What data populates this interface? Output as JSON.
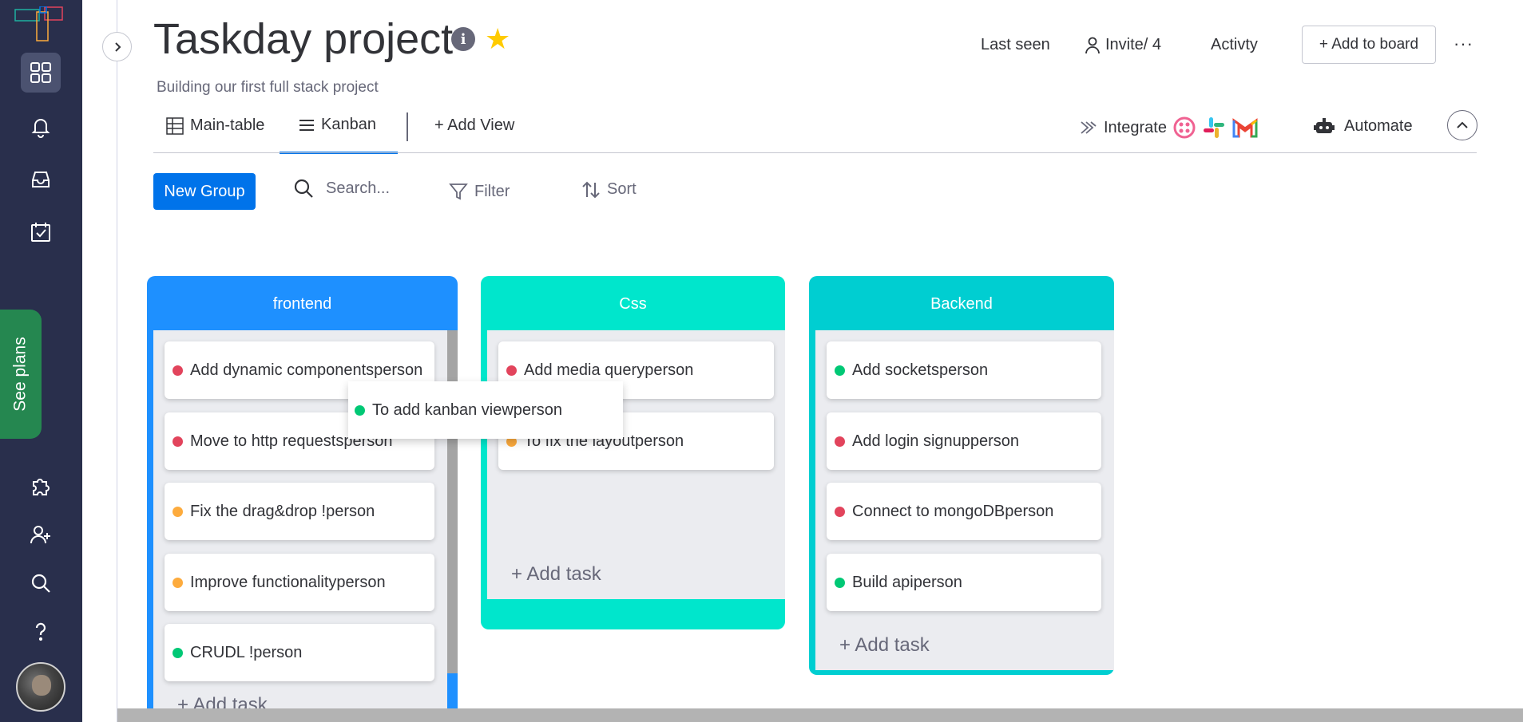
{
  "header": {
    "title": "Taskday project",
    "description": "Building our first full stack project",
    "info_icon": "info-icon",
    "star_icon": "star-icon",
    "last_seen": "Last seen",
    "invite": "Invite/ 4",
    "activity": "Activty",
    "add_to_board": "+ Add to board",
    "more": "···"
  },
  "sidebar": {
    "items": [
      {
        "name": "workspaces",
        "icon": "grid-icon"
      },
      {
        "name": "notifications",
        "icon": "bell-icon"
      },
      {
        "name": "inbox",
        "icon": "inbox-icon"
      },
      {
        "name": "my-work",
        "icon": "calendar-check-icon"
      },
      {
        "name": "apps",
        "icon": "puzzle-icon"
      },
      {
        "name": "invite-members",
        "icon": "add-user-icon"
      },
      {
        "name": "search",
        "icon": "search-icon"
      },
      {
        "name": "help",
        "icon": "help-icon"
      }
    ],
    "see_plans": "See plans"
  },
  "tabs": {
    "main_table": "Main-table",
    "kanban": "Kanban",
    "add_view": "+ Add View",
    "integrate": "Integrate",
    "automate": "Automate"
  },
  "toolbar": {
    "new_group": "New Group",
    "search_placeholder": "Search...",
    "filter": "Filter",
    "sort": "Sort"
  },
  "colors": {
    "sidebar": "#292f4c",
    "accent": "#0073ea",
    "status_red": "#e2445c",
    "status_orange": "#fdab3d",
    "status_green": "#00c875",
    "group_frontend": "#1e90ff",
    "group_css": "#00e6cc",
    "group_backend": "#00ced1"
  },
  "groups": [
    {
      "title": "frontend",
      "tasks": [
        {
          "text": "Add dynamic componentsperson",
          "status": "red"
        },
        {
          "text": "Move to http requestsperson",
          "status": "red"
        },
        {
          "text": "Fix the drag&drop !person",
          "status": "orange"
        },
        {
          "text": "Improve functionalityperson",
          "status": "orange"
        },
        {
          "text": "CRUDL !person",
          "status": "green"
        }
      ],
      "add_task": "+ Add task"
    },
    {
      "title": "Css",
      "tasks": [
        {
          "text": "Add media queryperson",
          "status": "red"
        },
        {
          "text": "To fix the layoutperson",
          "status": "orange"
        }
      ],
      "add_task": "+ Add task"
    },
    {
      "title": "Backend",
      "tasks": [
        {
          "text": "Add socketsperson",
          "status": "green"
        },
        {
          "text": "Add login signupperson",
          "status": "red"
        },
        {
          "text": "Connect to mongoDBperson",
          "status": "red"
        },
        {
          "text": "Build apiperson",
          "status": "green"
        }
      ],
      "add_task": "+ Add task"
    }
  ],
  "dragging_card": {
    "text": "To add kanban viewperson",
    "status": "green"
  }
}
